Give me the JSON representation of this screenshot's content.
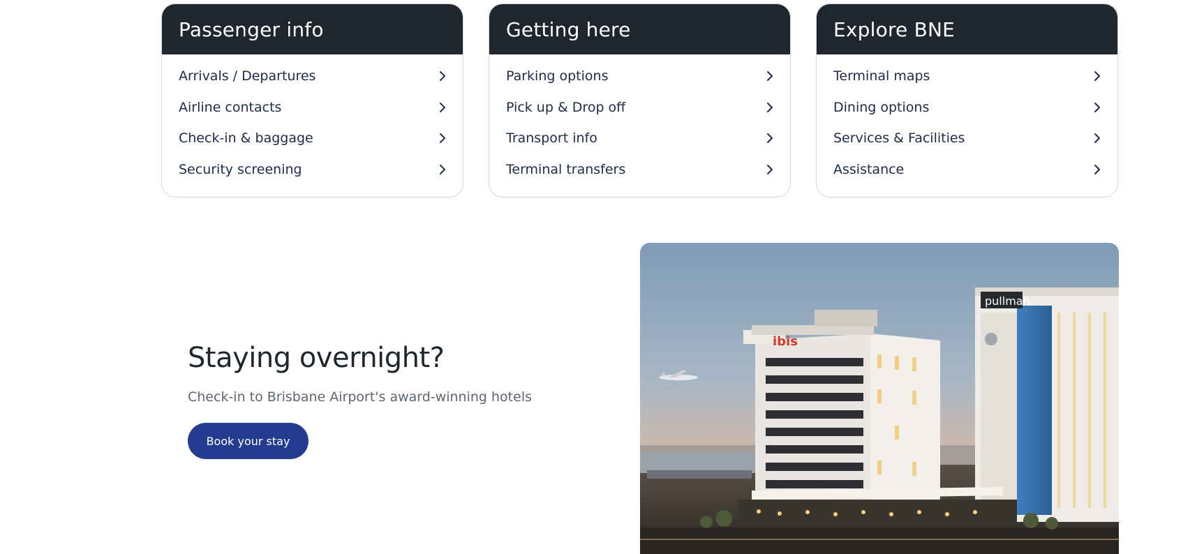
{
  "cards": [
    {
      "title": "Passenger info",
      "items": [
        {
          "label": "Arrivals / Departures"
        },
        {
          "label": "Airline contacts"
        },
        {
          "label": "Check-in & baggage"
        },
        {
          "label": "Security screening"
        }
      ]
    },
    {
      "title": "Getting here",
      "items": [
        {
          "label": "Parking options"
        },
        {
          "label": "Pick up & Drop off"
        },
        {
          "label": "Transport info"
        },
        {
          "label": "Terminal transfers"
        }
      ]
    },
    {
      "title": "Explore BNE",
      "items": [
        {
          "label": "Terminal maps"
        },
        {
          "label": "Dining options"
        },
        {
          "label": "Services & Facilities"
        },
        {
          "label": "Assistance"
        }
      ]
    }
  ],
  "hero": {
    "title": "Staying overnight?",
    "subtitle": "Check-in to Brisbane Airport's award-winning hotels",
    "button_label": "Book your stay",
    "image_signs": {
      "left_hotel": "ibis",
      "right_hotel": "pullman"
    }
  },
  "colors": {
    "card_header_bg": "#1f262e",
    "link_text": "#1c2b4a",
    "button_bg": "#243c8f",
    "subtitle_text": "#5f6570"
  },
  "icons": {
    "chevron": "chevron-right-icon"
  }
}
